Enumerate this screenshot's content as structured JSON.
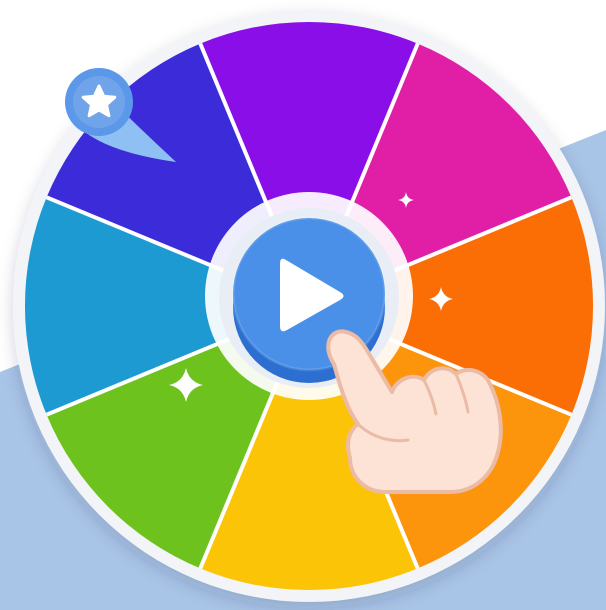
{
  "wheel": {
    "segment_count": 8,
    "segments": [
      {
        "color": "#8A0EE8"
      },
      {
        "color": "#E11EA6"
      },
      {
        "color": "#FB6D05"
      },
      {
        "color": "#FC950B"
      },
      {
        "color": "#FBC406"
      },
      {
        "color": "#6EC21E"
      },
      {
        "color": "#1E9AD2"
      },
      {
        "color": "#3B2BD8"
      }
    ],
    "rim_color": "#F2F4F8",
    "divider_color": "#FFFFFF"
  },
  "spin_button": {
    "icon": "play-icon",
    "color": "#4A90E8",
    "shadow_color": "#2C6FD0"
  },
  "pointer": {
    "icon": "star-icon",
    "color": "#5C98E9",
    "tail_color": "#8EC0F3"
  },
  "hand": {
    "icon": "pointing-hand-icon",
    "color": "#FCE3D5",
    "outline_color": "#EBBBA5"
  },
  "sparkles": {
    "icon": "sparkle-icon",
    "color": "#FFFFFF"
  },
  "background": {
    "color": "#FFFFFF",
    "band_color": "#A8C4E6"
  }
}
